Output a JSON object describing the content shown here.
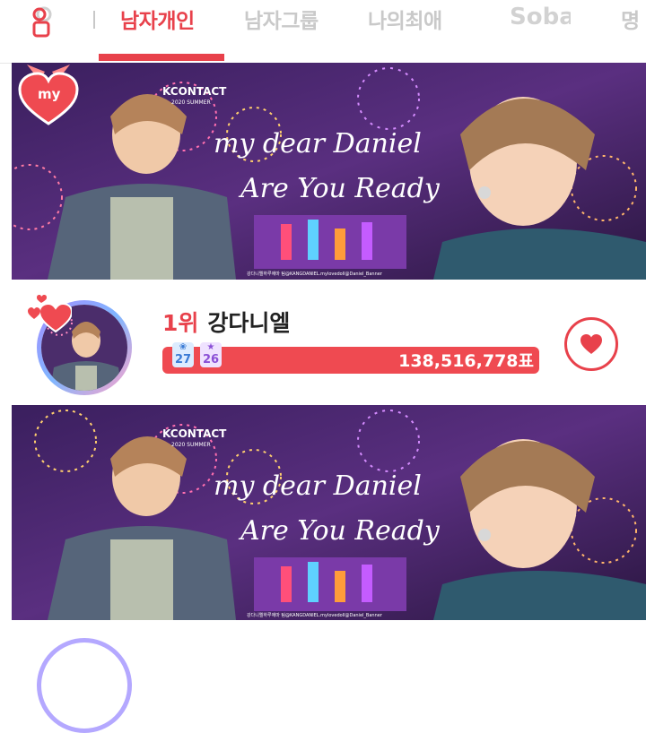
{
  "header": {
    "tabs": [
      {
        "label": "남자개인",
        "active": true
      },
      {
        "label": "남자그룹",
        "active": false
      },
      {
        "label": "나의최애",
        "active": false
      }
    ],
    "edge_tab_label": "명",
    "logo_text": "Soba",
    "icons": [
      "person-icon",
      "soba-logo"
    ]
  },
  "banner": {
    "event_label": "KCONTACT",
    "event_sub": "2020 SUMMER",
    "script_line_1": "my dear Daniel",
    "script_line_2": "Are You Ready",
    "credit": "강다니엘하루애마 팀@KANGDANIEL.mylovedoll@Daniel_Banner"
  },
  "my_badge": {
    "label": "my"
  },
  "ranking": {
    "rank": "1위",
    "artist": "강다니엘",
    "level_badges": [
      "27",
      "26"
    ],
    "votes": "138,516,778표"
  },
  "colors": {
    "accent": "#e8414b",
    "bar": "#ef4a51",
    "tab_inactive": "#c9c9c9"
  }
}
